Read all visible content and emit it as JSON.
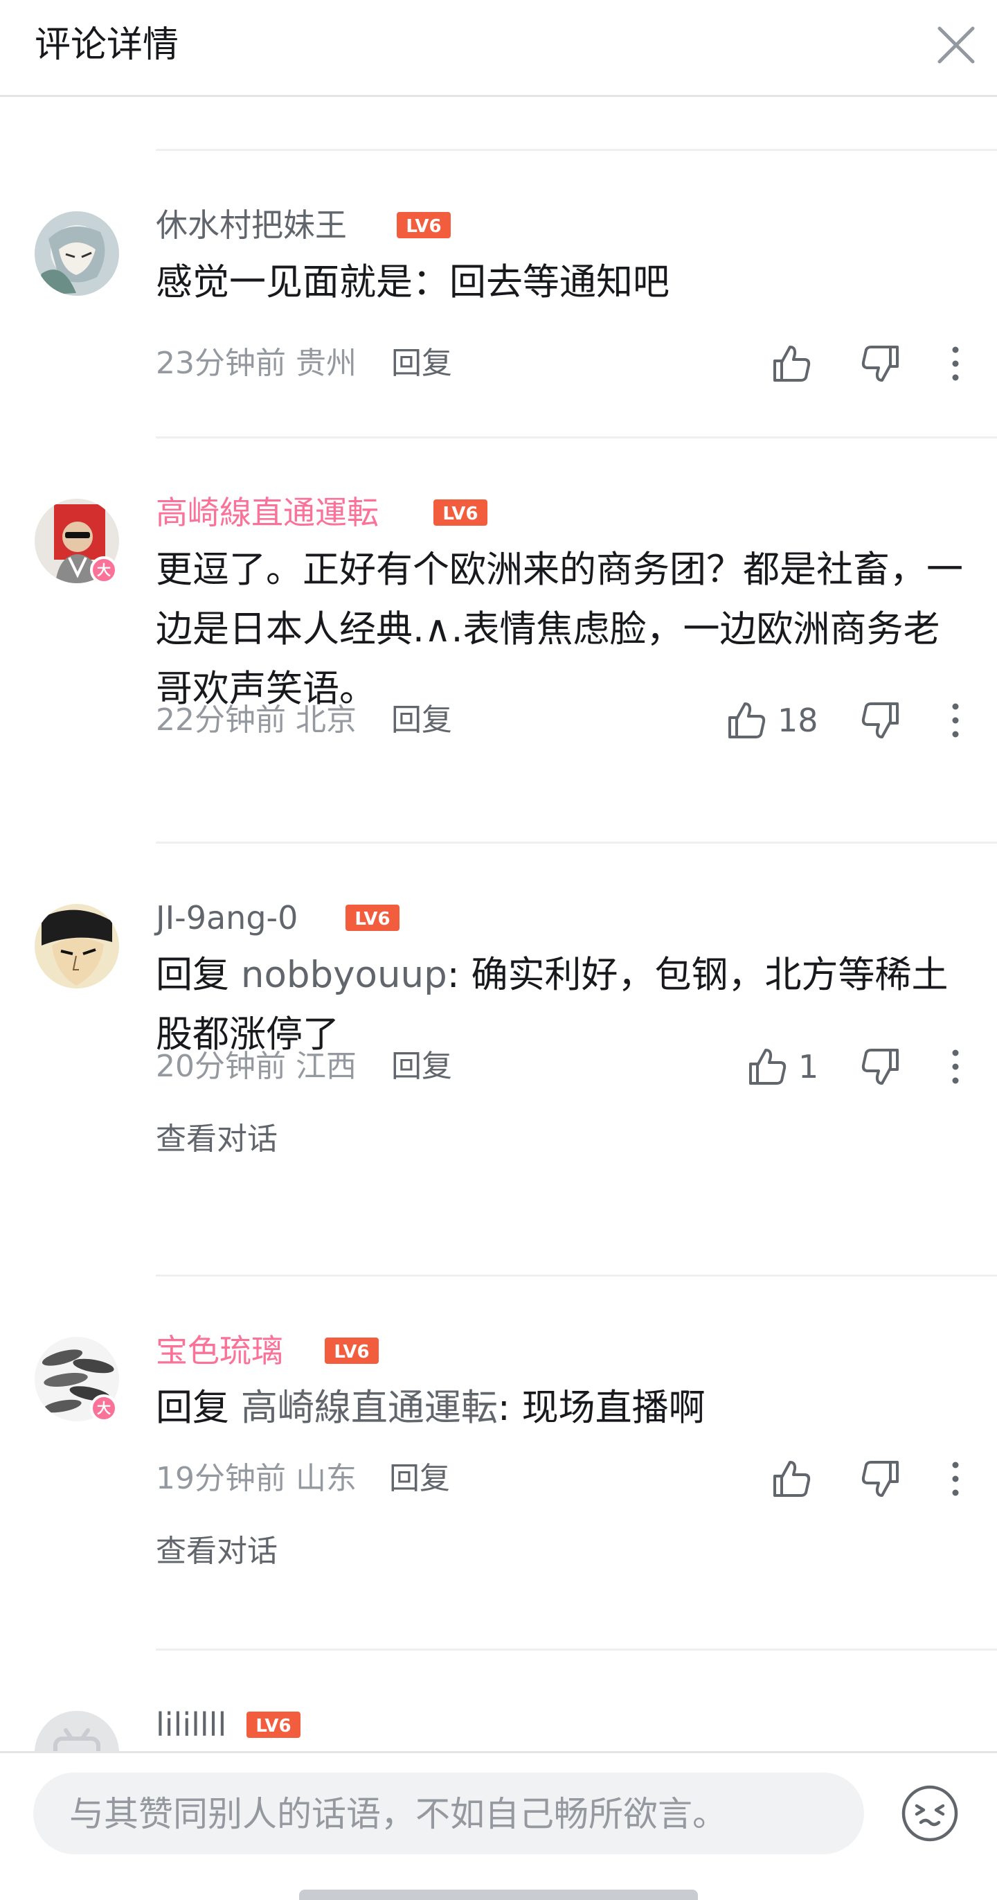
{
  "header": {
    "title": "评论详情",
    "close_icon": "close-icon"
  },
  "comments": [
    {
      "username": "休水村把妹王",
      "name_color": "#61666d",
      "level": "LV6",
      "content": "感觉一见面就是：回去等通知吧",
      "time": "23分钟前",
      "location": "贵州",
      "reply_label": "回复",
      "likes": "",
      "has_badge": false
    },
    {
      "username": "高崎線直通運転",
      "name_color": "#fb7299",
      "level": "LV6",
      "content": "更逗了。正好有个欧洲来的商务团？都是社畜，一边是日本人经典.∧.表情焦虑脸，一边欧洲商务老哥欢声笑语。",
      "time": "22分钟前",
      "location": "北京",
      "reply_label": "回复",
      "likes": "18",
      "has_badge": true,
      "badge_text": "大"
    },
    {
      "username": "JI-9ang-0",
      "name_color": "#61666d",
      "level": "LV6",
      "reply_prefix": "回复 ",
      "reply_to": "nobbyouup",
      "content": ": 确实利好，包钢，北方等稀土股都涨停了",
      "time": "20分钟前",
      "location": "江西",
      "reply_label": "回复",
      "likes": "1",
      "view_conversation": "查看对话",
      "has_badge": false
    },
    {
      "username": "宝色琉璃",
      "name_color": "#fb7299",
      "level": "LV6",
      "reply_prefix": "回复 ",
      "reply_to": "高崎線直通運転",
      "content": ": 现场直播啊",
      "time": "19分钟前",
      "location": "山东",
      "reply_label": "回复",
      "likes": "",
      "view_conversation": "查看对话",
      "has_badge": true,
      "badge_text": "大"
    },
    {
      "username": "lilillll",
      "name_color": "#61666d",
      "level": "LV6",
      "has_badge": false
    }
  ],
  "input": {
    "placeholder": "与其赞同别人的话语，不如自己畅所欲言。"
  },
  "colors": {
    "accent_pink": "#fb7299",
    "level_red": "#f25d3d",
    "text_gray": "#9499a0"
  }
}
